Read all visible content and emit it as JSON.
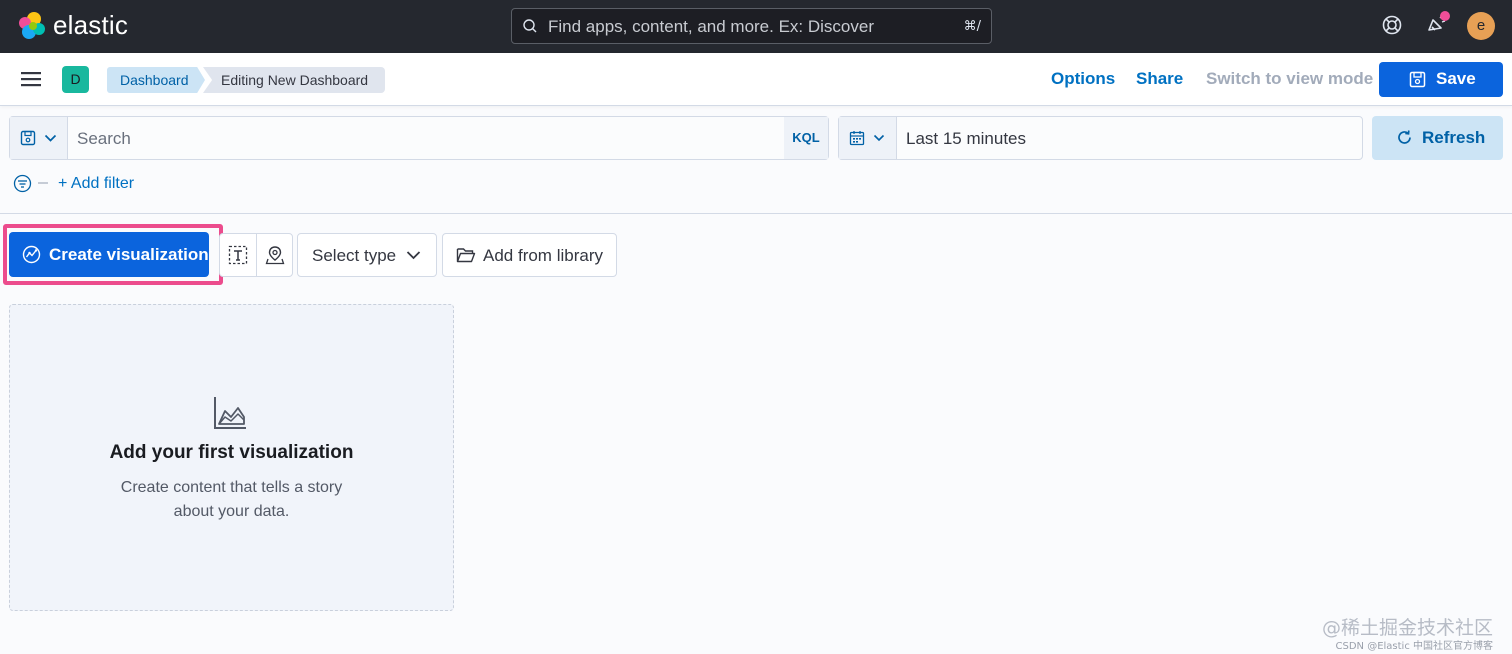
{
  "header": {
    "brand": "elastic",
    "search_placeholder": "Find apps, content, and more. Ex: Discover",
    "search_shortcut": "⌘/",
    "user_initial": "e",
    "icons": [
      "elastic-logo-icon",
      "search-icon",
      "help-icon",
      "newsfeed-icon"
    ],
    "notification_dot_color": "#f04e98"
  },
  "nav": {
    "space_initial": "D",
    "breadcrumbs": [
      "Dashboard",
      "Editing New Dashboard"
    ],
    "options_label": "Options",
    "share_label": "Share",
    "switch_label": "Switch to view mode",
    "save_label": "Save"
  },
  "query": {
    "search_placeholder": "Search",
    "language": "KQL",
    "time_range": "Last 15 minutes",
    "refresh_label": "Refresh",
    "add_filter_label": "+ Add filter"
  },
  "toolbar": {
    "create_label": "Create visualization",
    "select_type_label": "Select type",
    "library_label": "Add from library"
  },
  "empty_state": {
    "title": "Add your first visualization",
    "description": "Create content that tells a story about your data."
  },
  "watermark": {
    "line1": "@稀土掘金技术社区",
    "line2": "CSDN @Elastic 中国社区官方博客"
  },
  "colors": {
    "header_bg": "#25282f",
    "primary": "#0b64dd",
    "link": "#0071c2",
    "highlight": "#ec4c8d"
  }
}
